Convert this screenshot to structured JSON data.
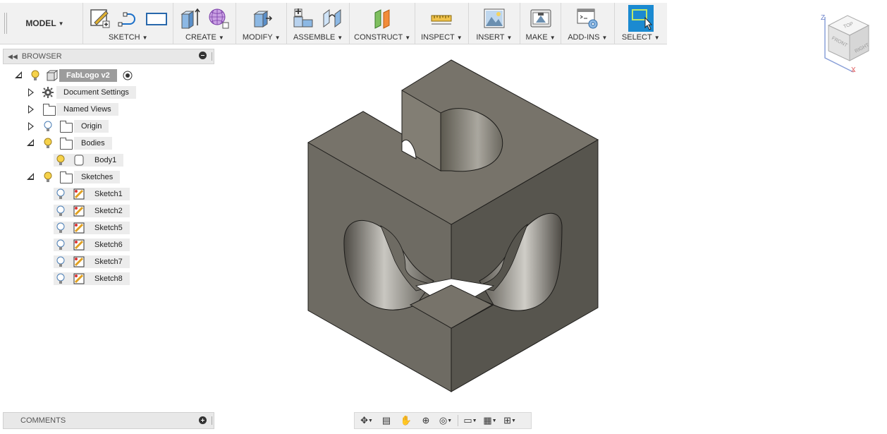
{
  "toolbar": {
    "model_label": "MODEL",
    "groups": [
      {
        "label": "SKETCH"
      },
      {
        "label": "CREATE"
      },
      {
        "label": "MODIFY"
      },
      {
        "label": "ASSEMBLE"
      },
      {
        "label": "CONSTRUCT"
      },
      {
        "label": "INSPECT"
      },
      {
        "label": "INSERT"
      },
      {
        "label": "MAKE"
      },
      {
        "label": "ADD-INS"
      },
      {
        "label": "SELECT"
      }
    ]
  },
  "browser": {
    "title": "BROWSER",
    "root": "FabLogo v2",
    "items": [
      {
        "label": "Document Settings"
      },
      {
        "label": "Named Views"
      },
      {
        "label": "Origin"
      },
      {
        "label": "Bodies"
      },
      {
        "label": "Body1"
      },
      {
        "label": "Sketches"
      },
      {
        "label": "Sketch1"
      },
      {
        "label": "Sketch2"
      },
      {
        "label": "Sketch5"
      },
      {
        "label": "Sketch6"
      },
      {
        "label": "Sketch7"
      },
      {
        "label": "Sketch8"
      }
    ]
  },
  "comments": {
    "title": "COMMENTS"
  },
  "viewcube": {
    "top": "TOP",
    "front": "FRONT",
    "right": "RIGHT",
    "axis_z": "Z",
    "axis_x": "X"
  },
  "colors": {
    "accent": "#1b8ad1",
    "model_light": "#6e6b63",
    "model_dark": "#55534c",
    "model_top": "#7a766c"
  }
}
